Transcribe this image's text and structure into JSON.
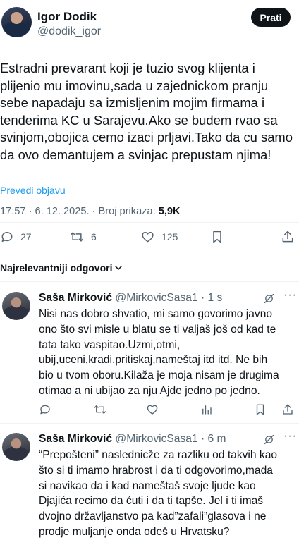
{
  "author": {
    "name": "Igor Dodik",
    "handle": "@dodik_igor",
    "follow_label": "Prati"
  },
  "tweet": {
    "text": "Estradni prevarant koji je tuzio svog klijenta i\nplijenio mu imovinu,sada u zajednickom pranju\nsebe napadaju sa izmisljenim mojim firmama i\ntenderima KC u Sarajevu.Ako se budem rvao sa\nsvinjom,obojica cemo izaci prljavi.Tako da cu samo\nda ovo demantujem a svinjac prepustam njima!",
    "translate_label": "Prevedi objavu",
    "time": "17:57 · 6. 12. 2025. · ",
    "views_label": "Broj prikaza: ",
    "views": "5,9K",
    "replies": "27",
    "reposts": "6",
    "likes": "125"
  },
  "sort_label": "Najrelevantniji odgovori",
  "replies": [
    {
      "name": "Saša Mirković",
      "handle": "@MirkovicSasa1",
      "time": " · 1 s",
      "text": "Nisi nas dobro shvatio, mi samo govorimo javno\nono što svi misle u blatu se ti valjaš još od kad te\ntata tako vaspitao.Uzmi,otmi,\nubij,uceni,kradi,pritiskaj,nameštaj itd itd. Ne bih\nbio u tvom oboru.Kilaža je moja nisam je drugima\notimao a ni ubijao za nju Ajde jedno  po jedno."
    },
    {
      "name": "Saša Mirković",
      "handle": "@MirkovicSasa1",
      "time": " · 6 m",
      "text": "“Prepošteni” naslednicže za razliku od takvih kao\nšto si ti imamo hrabrost i da ti odgovorimo,mada\nsi navikao da i kad nameštaš svoje ljude kao\nDjajića recimo da ćuti i da ti tapše. Jel i ti imaš\ndvojno državljanstvo pa kad”zafali”glasova i ne\nprodje muljanje onda odeš u Hrvatsku?"
    }
  ]
}
